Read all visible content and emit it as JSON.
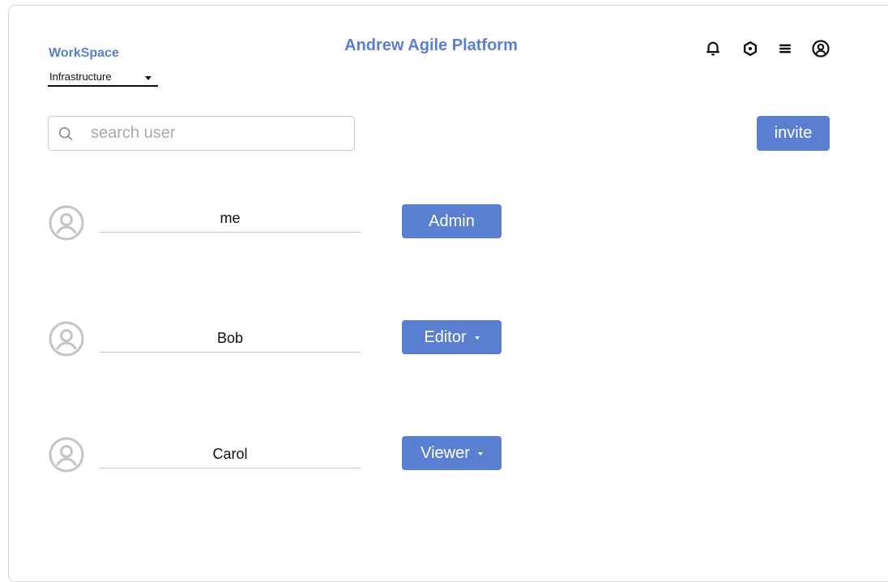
{
  "header": {
    "workspace_label": "WorkSpace",
    "workspace_selected": "Infrastructure",
    "title": "Andrew Agile Platform",
    "icons": [
      "bell-icon",
      "gear-icon",
      "menu-icon",
      "account-icon"
    ]
  },
  "search": {
    "placeholder": "search user",
    "value": ""
  },
  "invite_label": "invite",
  "users": [
    {
      "name": "me",
      "role": "Admin",
      "role_has_dropdown": false
    },
    {
      "name": "Bob",
      "role": "Editor",
      "role_has_dropdown": true
    },
    {
      "name": "Carol",
      "role": "Viewer",
      "role_has_dropdown": true
    }
  ],
  "colors": {
    "accent": "#5b7fd0",
    "avatar_gray": "#c4c4c4",
    "border": "#c8c8c8"
  }
}
